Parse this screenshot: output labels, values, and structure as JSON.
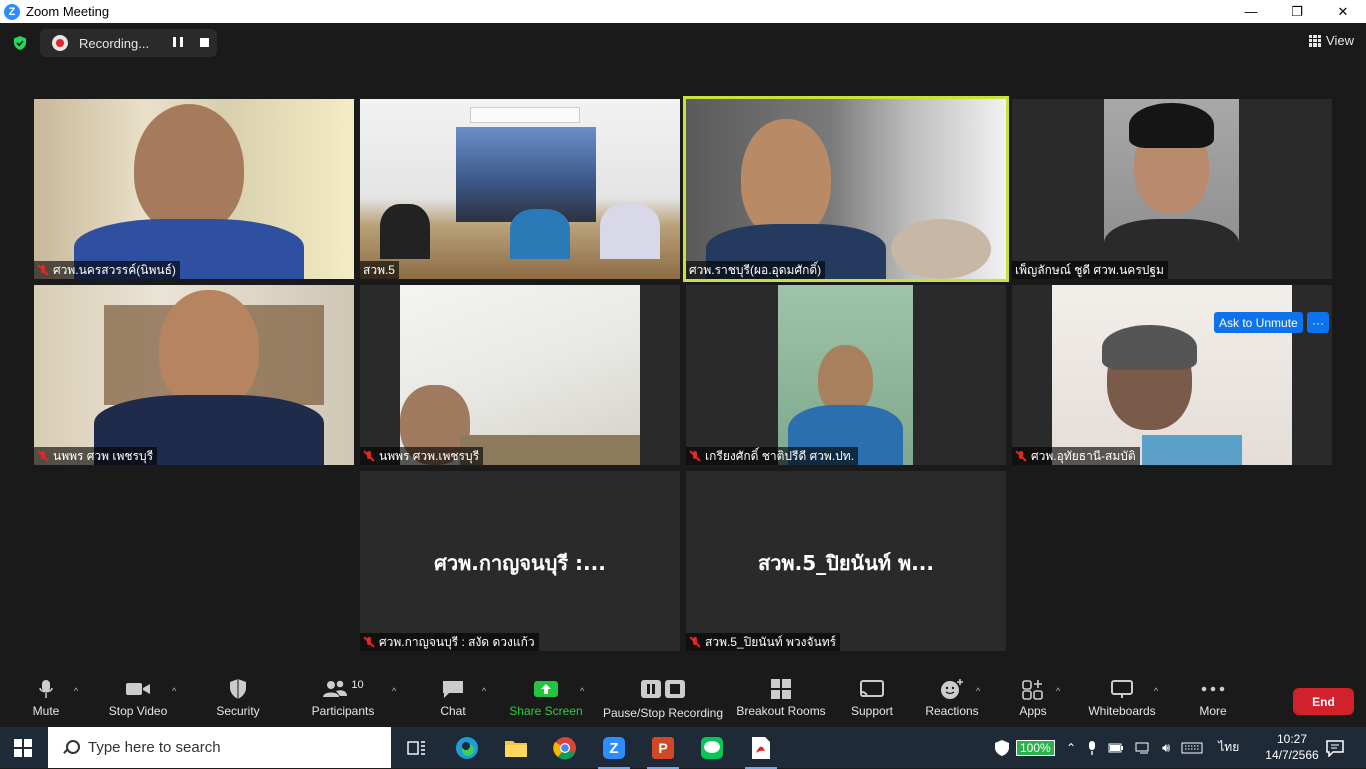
{
  "window": {
    "title": "Zoom Meeting",
    "logo": "Z",
    "minimize": "—",
    "maximize": "❐",
    "close": "✕"
  },
  "topbar": {
    "recording_label": "Recording...",
    "view_label": "View"
  },
  "tiles": [
    {
      "name": "ศวพ.นครสวรรค์(นิพนธ์)",
      "muted": true
    },
    {
      "name": "สวพ.5",
      "muted": false
    },
    {
      "name": "ศวพ.ราชบุรี(ผอ.อุดมศักดิ์)",
      "muted": false,
      "active": true
    },
    {
      "name": "เพ็ญลักษณ์ ชูดี ศวพ.นครปฐม",
      "muted": false
    },
    {
      "name": "นพพร ศวพ เพชรบุรี",
      "muted": true
    },
    {
      "name": "นพพร ศวพ.เพชรบุรี",
      "muted": true
    },
    {
      "name": "เกรียงศักดิ์ ชาติปรีดี ศวพ.ปท.",
      "muted": true
    },
    {
      "name": "ศวพ.อุทัยธานี-สมบัติ",
      "muted": true
    },
    {
      "name": "ศวพ.กาญจนบุรี : สงัด ดวงแก้ว",
      "muted": true,
      "display": "ศวพ.กาญจนบุรี :..."
    },
    {
      "name": "สวพ.5_ปิยนันท์ พวงจันทร์",
      "muted": true,
      "display": "สวพ.5_ปิยนันท์ พ..."
    }
  ],
  "ask_unmute": {
    "label": "Ask to Unmute",
    "more": "···"
  },
  "toolbar": {
    "mute": "Mute",
    "stop_video": "Stop Video",
    "security": "Security",
    "participants": "Participants",
    "participants_count": "10",
    "chat": "Chat",
    "share_screen": "Share Screen",
    "pause_stop_recording": "Pause/Stop Recording",
    "breakout_rooms": "Breakout Rooms",
    "support": "Support",
    "reactions": "Reactions",
    "apps": "Apps",
    "whiteboards": "Whiteboards",
    "more": "More",
    "end": "End",
    "caret": "^"
  },
  "taskbar": {
    "search_placeholder": "Type here to search",
    "battery": "100%",
    "language": "ไทย",
    "time": "10:27",
    "date": "14/7/2566"
  },
  "colors": {
    "active_speaker": "#c7e23a",
    "zoom_blue": "#0e72ed",
    "end_red": "#d1222b",
    "share_green": "#2ecc40",
    "muted_red": "#e02828"
  }
}
